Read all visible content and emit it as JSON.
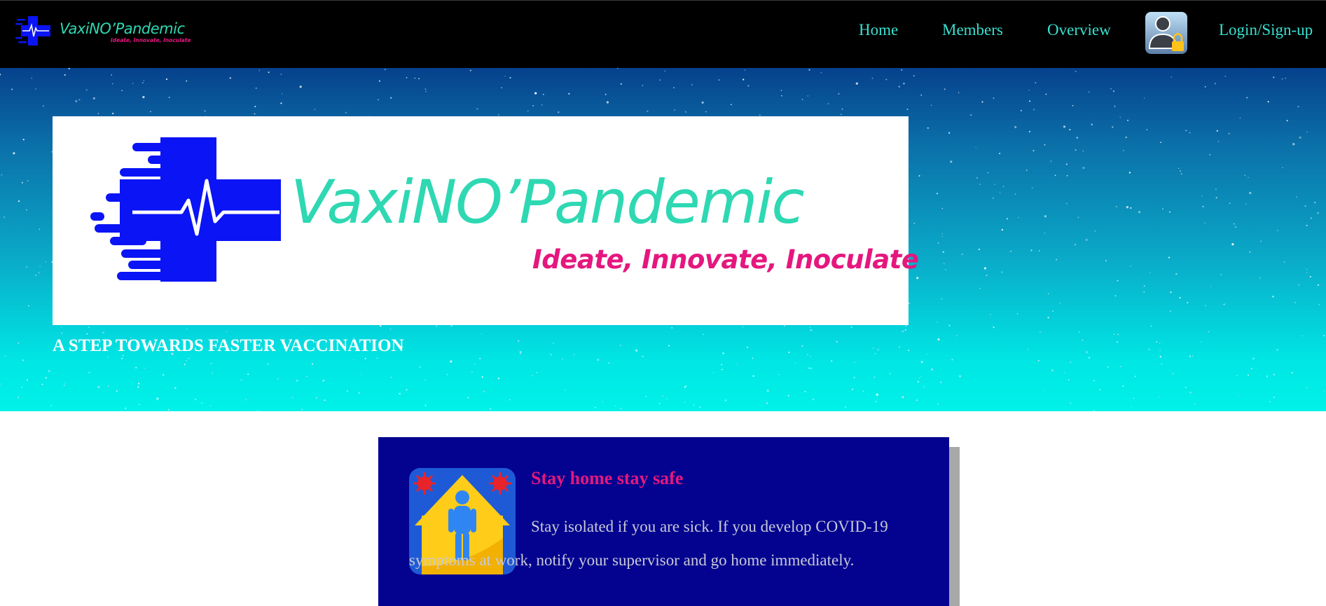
{
  "brand": {
    "name": "VaxiNO’Pandemic",
    "tagline": "Ideate, Innovate, Inoculate",
    "logo_icon": "medical-cross-pulse-icon",
    "colors": {
      "primary_blue": "#0a14f5",
      "teal": "#2ed8b2",
      "magenta": "#e5177e"
    }
  },
  "nav": {
    "home": "Home",
    "members": "Members",
    "overview": "Overview",
    "user_icon": "user-lock-icon",
    "login": "Login/Sign-up",
    "link_color": "#39e0d0"
  },
  "hero": {
    "banner_name": "VaxiNO’Pandemic",
    "banner_tagline": "Ideate, Innovate, Inoculate",
    "subtitle": "A STEP TOWARDS FASTER VACCINATION"
  },
  "card": {
    "icon": "stay-home-house-icon",
    "title": "Stay home stay safe",
    "text": "Stay isolated if you are sick. If you develop COVID-19 symptoms at work, notify your supervisor and go home immediately."
  }
}
